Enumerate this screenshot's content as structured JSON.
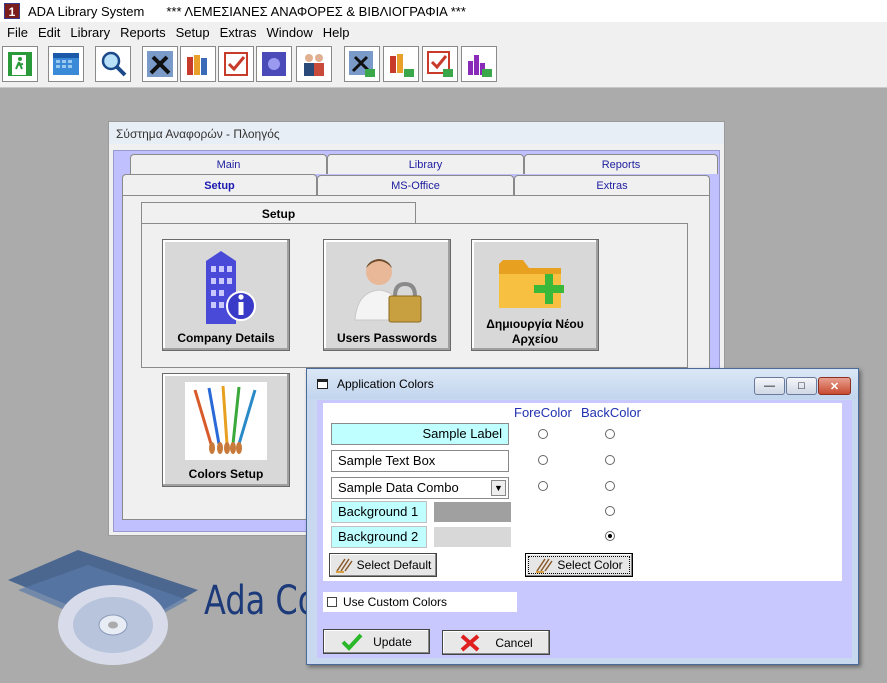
{
  "app": {
    "title": "ADA Library System",
    "subtitle": "*** ΛΕΜΕΣΙΑΝΕΣ ΑΝΑΦΟΡΕΣ & ΒΙΒΛΙΟΓΡΑΦΙΑ ***"
  },
  "menu": [
    "File",
    "Edit",
    "Library",
    "Reports",
    "Setup",
    "Extras",
    "Window",
    "Help"
  ],
  "main_window": {
    "title": "Σύστημα Αναφορών - Πλοηγός",
    "tabs_top": [
      "Main",
      "Library",
      "Reports"
    ],
    "tabs_bottom": [
      "Setup",
      "MS-Office",
      "Extras"
    ],
    "active_tab": "Setup",
    "inner_tab": "Setup",
    "buttons": {
      "company": "Company Details",
      "users": "Users Passwords",
      "newfile": "Δημιουργία Νέου Αρχείου",
      "colors": "Colors Setup"
    }
  },
  "watermark": {
    "text": "Ada Cor"
  },
  "dialog": {
    "title": "Application Colors",
    "col_fore": "ForeColor",
    "col_back": "BackColor",
    "sample_label": "Sample Label",
    "sample_textbox": "Sample Text Box",
    "sample_combo": "Sample Data Combo",
    "background1": "Background 1",
    "background2": "Background 2",
    "select_default": "Select Default",
    "select_color": "Select Color",
    "use_custom": "Use Custom Colors",
    "update": "Update",
    "cancel": "Cancel",
    "selected_backcolor_row": "Background 2",
    "colors": {
      "label_bg": "#c0ffff",
      "bg1_swatch": "#a0a0a0",
      "bg2_swatch": "#d8d8d8",
      "panel": "#c8c8ff"
    }
  }
}
